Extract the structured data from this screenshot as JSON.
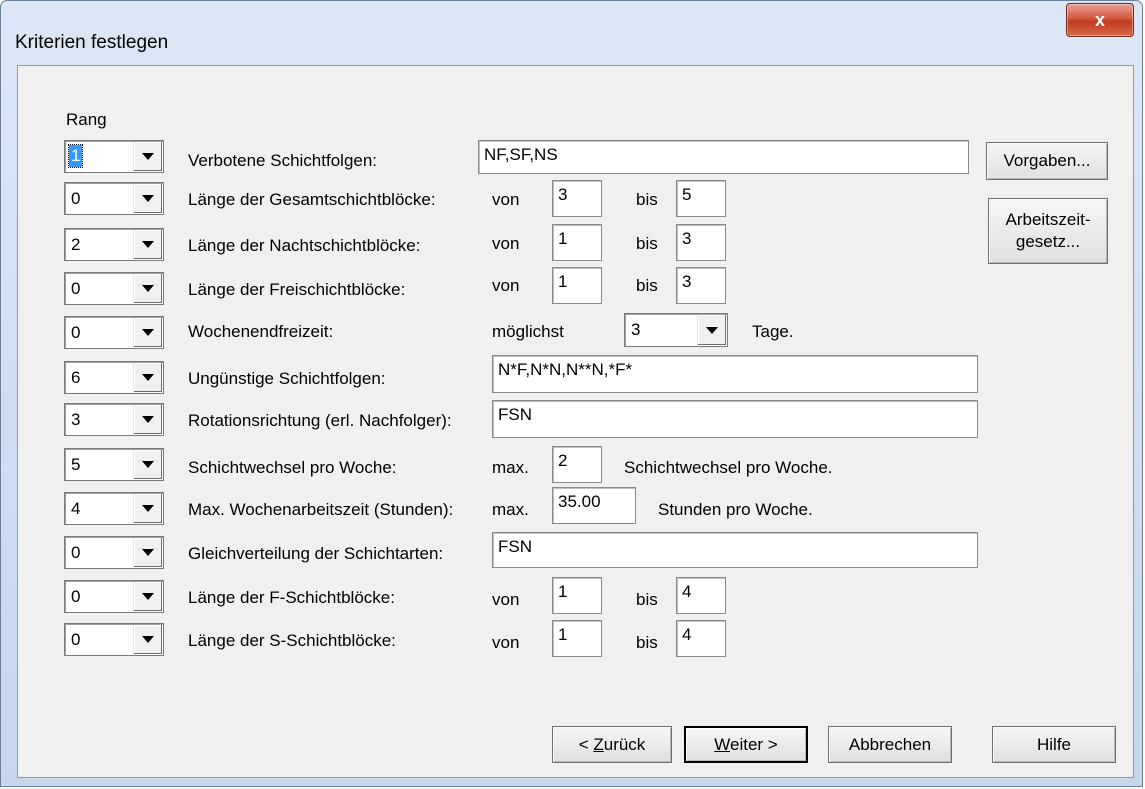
{
  "window": {
    "title": "Kriterien festlegen",
    "close_label": "x"
  },
  "rang_label": "Rang",
  "rows": [
    {
      "rank": "1",
      "label": "Verbotene Schichtfolgen:",
      "value": "NF,SF,NS"
    },
    {
      "rank": "0",
      "label": "Länge der Gesamtschichtblöcke:",
      "from_label": "von",
      "from": "3",
      "to_label": "bis",
      "to": "5"
    },
    {
      "rank": "2",
      "label": "Länge der Nachtschichtblöcke:",
      "from_label": "von",
      "from": "1",
      "to_label": "bis",
      "to": "3"
    },
    {
      "rank": "0",
      "label": "Länge der Freischichtblöcke:",
      "from_label": "von",
      "from": "1",
      "to_label": "bis",
      "to": "3"
    },
    {
      "rank": "0",
      "label": "Wochenendfreizeit:",
      "prefix": "möglichst",
      "select_value": "3",
      "suffix": "Tage."
    },
    {
      "rank": "6",
      "label": "Ungünstige Schichtfolgen:",
      "value": "N*F,N*N,N**N,*F*"
    },
    {
      "rank": "3",
      "label": "Rotationsrichtung (erl. Nachfolger):",
      "value": "FSN"
    },
    {
      "rank": "5",
      "label": "Schichtwechsel pro Woche:",
      "prefix": "max.",
      "value": "2",
      "suffix": "Schichtwechsel pro Woche."
    },
    {
      "rank": "4",
      "label": "Max. Wochenarbeitszeit (Stunden):",
      "prefix": "max.",
      "value": "35.00",
      "suffix": "Stunden pro Woche."
    },
    {
      "rank": "0",
      "label": "Gleichverteilung der Schichtarten:",
      "value": "FSN"
    },
    {
      "rank": "0",
      "label": "Länge der F-Schichtblöcke:",
      "from_label": "von",
      "from": "1",
      "to_label": "bis",
      "to": "4"
    },
    {
      "rank": "0",
      "label": "Länge der S-Schichtblöcke:",
      "from_label": "von",
      "from": "1",
      "to_label": "bis",
      "to": "4"
    }
  ],
  "side_buttons": {
    "defaults": "Vorgaben...",
    "law_line1": "Arbeitszeit-",
    "law_line2": "gesetz..."
  },
  "footer": {
    "back_prefix": "< ",
    "back_mnemonic": "Z",
    "back_rest": "urück",
    "next_mnemonic": "W",
    "next_rest": "eiter >",
    "cancel": "Abbrechen",
    "help": "Hilfe"
  }
}
